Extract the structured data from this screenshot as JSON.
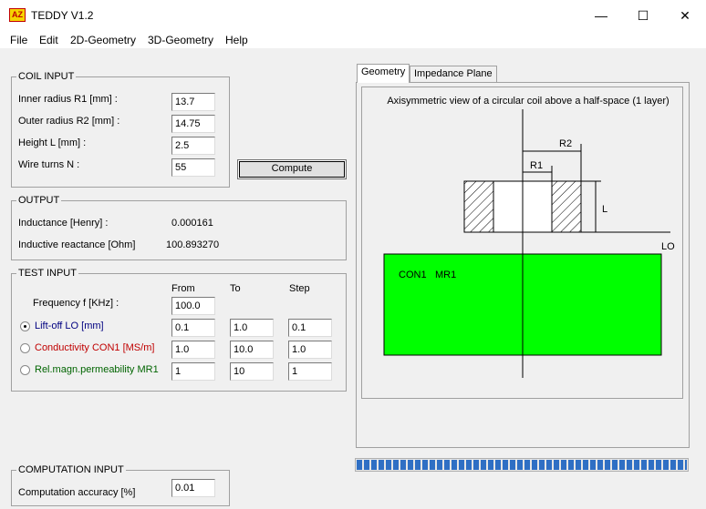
{
  "window": {
    "icon_text": "AZ",
    "title": "TEDDY V1.2",
    "minimize": "—",
    "maximize": "☐",
    "close": "✕"
  },
  "menu": [
    "File",
    "Edit",
    "2D-Geometry",
    "3D-Geometry",
    "Help"
  ],
  "coil_input": {
    "title": "COIL INPUT",
    "fields": [
      {
        "label": "Inner radius R1 [mm] :",
        "value": "13.7"
      },
      {
        "label": "Outer radius R2 [mm] :",
        "value": "14.75"
      },
      {
        "label": "Height L [mm] :",
        "value": "2.5"
      },
      {
        "label": "Wire turns N :",
        "value": "55"
      }
    ],
    "compute_label": "Compute"
  },
  "output": {
    "title": "OUTPUT",
    "rows": [
      {
        "label": "Inductance [Henry] :",
        "value": "0.000161"
      },
      {
        "label": "Inductive reactance [Ohm]",
        "value": "100.893270"
      }
    ]
  },
  "test_input": {
    "title": "TEST INPUT",
    "col_from": "From",
    "col_to": "To",
    "col_step": "Step",
    "frequency_label": "Frequency f [KHz] :",
    "frequency_value": "100.0",
    "rows": [
      {
        "label": "Lift-off LO [mm]",
        "from": "0.1",
        "to": "1.0",
        "step": "0.1",
        "selected": true,
        "color": "#000080"
      },
      {
        "label": "Conductivity CON1 [MS/m]",
        "from": "1.0",
        "to": "10.0",
        "step": "1.0",
        "selected": false,
        "color": "#c00000"
      },
      {
        "label": "Rel.magn.permeability MR1",
        "from": "1",
        "to": "10",
        "step": "1",
        "selected": false,
        "color": "#006400"
      }
    ]
  },
  "computation_input": {
    "title": "COMPUTATION INPUT",
    "accuracy_label": "Computation accuracy [%]",
    "accuracy_value": "0.01"
  },
  "tabs": [
    {
      "label": "Geometry",
      "active": true
    },
    {
      "label": "Impedance Plane",
      "active": false
    }
  ],
  "geometry": {
    "caption": "Axisymmetric view of a circular coil above a half-space (1 layer)",
    "r1_label": "R1",
    "r2_label": "R2",
    "l_label": "L",
    "lo_label": "LO",
    "con_label": "CON1",
    "mr_label": "MR1",
    "halfspace_color": "#00ff00"
  },
  "progress": {
    "fraction": 1.0
  }
}
